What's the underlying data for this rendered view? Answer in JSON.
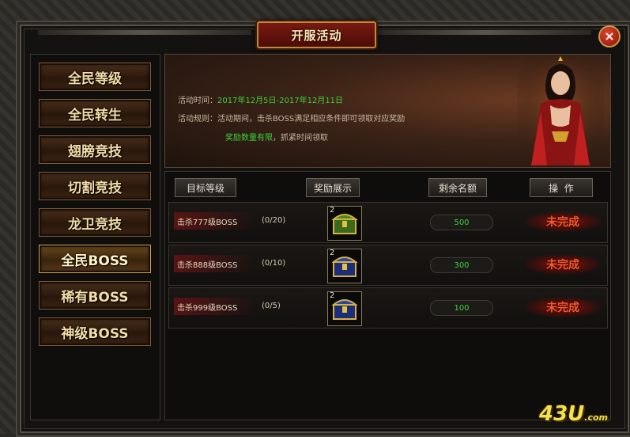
{
  "window": {
    "title": "开服活动",
    "close_glyph": "×"
  },
  "sidebar": {
    "items": [
      {
        "label": "全民等级"
      },
      {
        "label": "全民转生"
      },
      {
        "label": "翅膀竞技"
      },
      {
        "label": "切割竞技"
      },
      {
        "label": "龙卫竞技"
      },
      {
        "label": "全民BOSS",
        "active": true
      },
      {
        "label": "稀有BOSS"
      },
      {
        "label": "神级BOSS"
      }
    ]
  },
  "banner": {
    "time_label": "活动时间：",
    "time_value": "2017年12月5日-2017年12月11日",
    "rule_label": "活动规则：",
    "rule_text": "活动期间，击杀BOSS满足相应条件即可领取对应奖励",
    "tip_green": "奖励数量有限",
    "tip_rest": "，抓紧时间领取"
  },
  "table": {
    "headers": [
      "目标等级",
      "奖励展示",
      "剩余名额",
      "操  作"
    ],
    "rows": [
      {
        "target": "击杀777级BOSS",
        "progress": "(0/20)",
        "reward_count": "2",
        "reward_icon": "green-chest-icon",
        "remaining": "500",
        "status": "未完成"
      },
      {
        "target": "击杀888级BOSS",
        "progress": "(0/10)",
        "reward_count": "2",
        "reward_icon": "blue-chest-icon",
        "remaining": "300",
        "status": "未完成"
      },
      {
        "target": "击杀999级BOSS",
        "progress": "(0/5)",
        "reward_count": "2",
        "reward_icon": "blue-chest-icon",
        "remaining": "100",
        "status": "未完成"
      }
    ]
  },
  "watermark": {
    "text": "43U",
    "suffix": ".com"
  },
  "colors": {
    "accent_green": "#3bd23b",
    "status_red": "#ff5a2a",
    "gold_text": "#f2dca6"
  }
}
